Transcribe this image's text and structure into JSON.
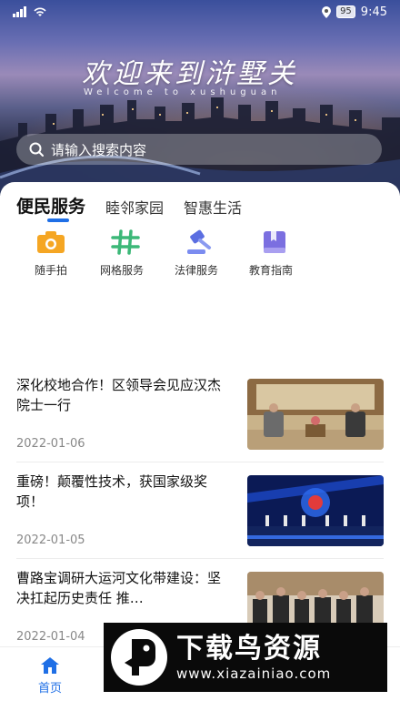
{
  "status_bar": {
    "battery": "95",
    "time": "9:45"
  },
  "hero": {
    "title": "欢迎来到浒墅关",
    "subtitle": "Welcome to xushuguan"
  },
  "search": {
    "placeholder": "请输入搜索内容"
  },
  "tabs": [
    {
      "label": "便民服务",
      "active": true
    },
    {
      "label": "睦邻家园",
      "active": false
    },
    {
      "label": "智惠生活",
      "active": false
    }
  ],
  "services": [
    {
      "label": "随手拍",
      "icon": "camera-icon"
    },
    {
      "label": "网格服务",
      "icon": "grid-icon"
    },
    {
      "label": "法律服务",
      "icon": "gavel-icon"
    },
    {
      "label": "教育指南",
      "icon": "book-icon"
    }
  ],
  "news": [
    {
      "title": "深化校地合作！区领导会见应汉杰院士一行",
      "date": "2022-01-06"
    },
    {
      "title": "重磅！颠覆性技术，获国家级奖项！",
      "date": "2022-01-05"
    },
    {
      "title": "曹路宝调研大运河文化带建设：坚决扛起历史责任 推…",
      "date": "2022-01-04"
    }
  ],
  "bottom_nav": [
    {
      "label": "首页",
      "active": true
    }
  ],
  "watermark": {
    "title": "下载鸟资源",
    "url": "www.xiazainiao.com"
  },
  "colors": {
    "accent": "#1f6fe6",
    "camera": "#f5a623",
    "grid": "#3cb878",
    "gavel": "#5b6ee1",
    "book": "#7b6fe0"
  }
}
